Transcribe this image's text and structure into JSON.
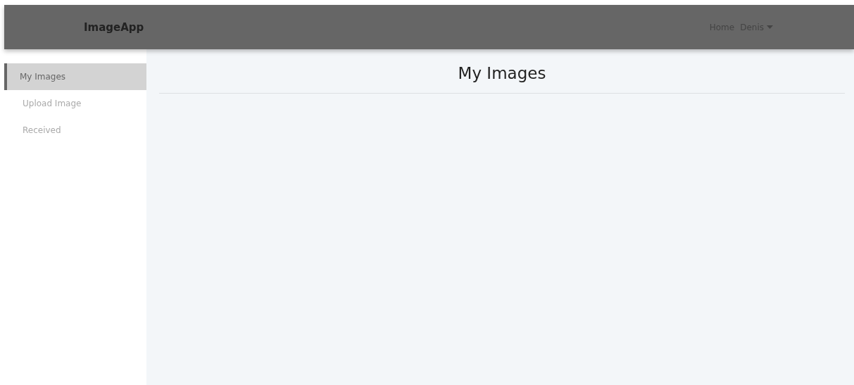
{
  "navbar": {
    "brand": "ImageApp",
    "links": [
      {
        "label": "Home",
        "kind": "link"
      },
      {
        "label": "Denis",
        "kind": "dropdown"
      }
    ]
  },
  "sidebar": {
    "items": [
      {
        "label": "My Images",
        "selected": true
      },
      {
        "label": "Upload Image",
        "selected": false
      },
      {
        "label": "Received",
        "selected": false
      }
    ]
  },
  "main": {
    "title": "My Images"
  }
}
